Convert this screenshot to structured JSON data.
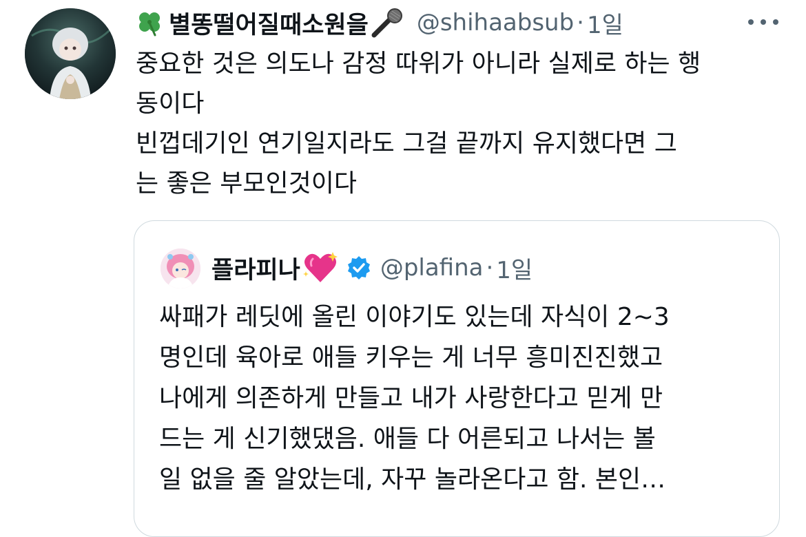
{
  "tweet": {
    "display_name": "별똥떨어질때소원을",
    "handle": "@shihaabsub",
    "separator": "·",
    "time": "1일",
    "lines": [
      "중요한 것은 의도나 감정 따위가 아니라 실제로 하는 행",
      "동이다",
      "빈껍데기인 연기일지라도 그걸 끝까지 유지했다면 그",
      "는 좋은 부모인것이다"
    ],
    "name_emoji_before": "four-leaf-clover-icon",
    "name_emoji_after": "microphone-icon"
  },
  "quote": {
    "display_name": "플라피나",
    "name_emoji": "sparkling-heart-icon",
    "verified": true,
    "handle": "@plafina",
    "separator": "·",
    "time": "1일",
    "lines": [
      "싸패가 레딧에 올린 이야기도 있는데 자식이 2~3",
      "명인데 육아로 애들 키우는 게 너무 흥미진진했고",
      "나에게 의존하게 만들고 내가 사랑한다고 믿게 만",
      "드는 게 신기했댔음. 애들 다 어른되고 나서는 볼",
      "일 없을 줄 알았는데, 자꾸 놀라온다고 함. 본인…"
    ]
  },
  "colors": {
    "text_primary": "#0f1419",
    "text_secondary": "#536471",
    "border": "#cfd9de",
    "verified_blue": "#1d9bf0"
  }
}
